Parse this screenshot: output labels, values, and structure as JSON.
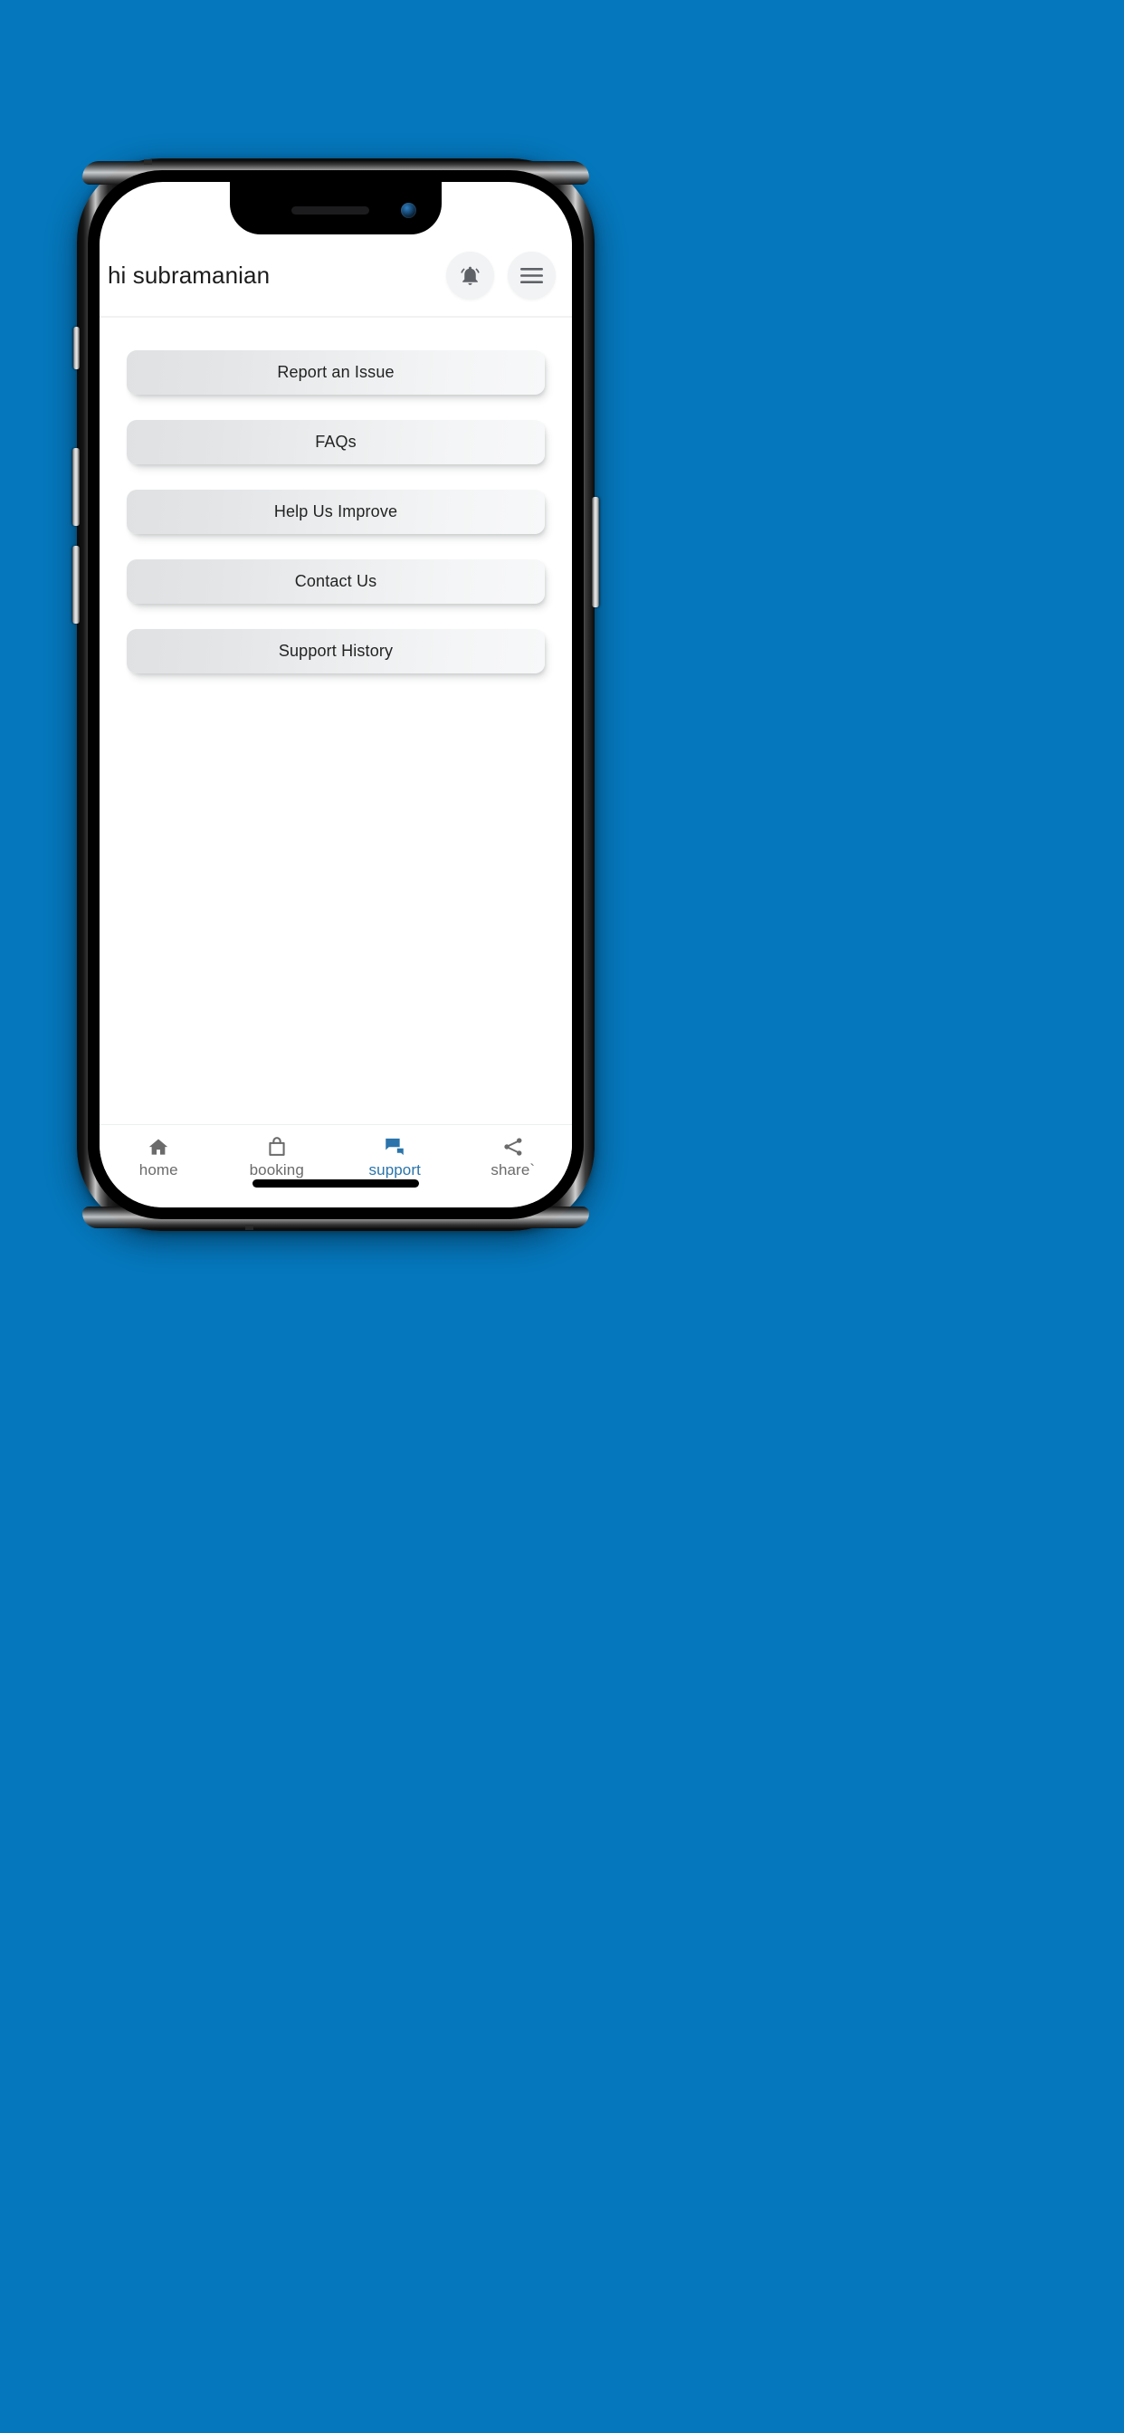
{
  "background": {
    "color": "#0577bc"
  },
  "device": {
    "frame": "iphone-x-mockup",
    "notch": {
      "speaker_icon": "speaker-slot",
      "camera_icon": "front-camera-icon"
    },
    "side_buttons": [
      "silent-switch",
      "volume-up-button",
      "volume-down-button",
      "power-button"
    ],
    "home_indicator": "home-indicator-bar"
  },
  "header": {
    "greeting": "hi subramanian",
    "notification_button": {
      "icon": "notification-bell-icon"
    },
    "menu_button": {
      "icon": "hamburger-menu-icon"
    }
  },
  "main": {
    "menu_items": [
      {
        "label": "Report an Issue"
      },
      {
        "label": "FAQs"
      },
      {
        "label": "Help Us Improve"
      },
      {
        "label": "Contact Us"
      },
      {
        "label": "Support History"
      }
    ]
  },
  "bottom_nav": {
    "active_color": "#2a74ab",
    "inactive_color": "#6b6b6b",
    "items": [
      {
        "label": "home",
        "icon": "home-icon",
        "active": false
      },
      {
        "label": "booking",
        "icon": "shopping-bag-icon",
        "active": false
      },
      {
        "label": "support",
        "icon": "chat-support-icon",
        "active": true
      },
      {
        "label": "share`",
        "icon": "share-icon",
        "active": false
      }
    ]
  }
}
